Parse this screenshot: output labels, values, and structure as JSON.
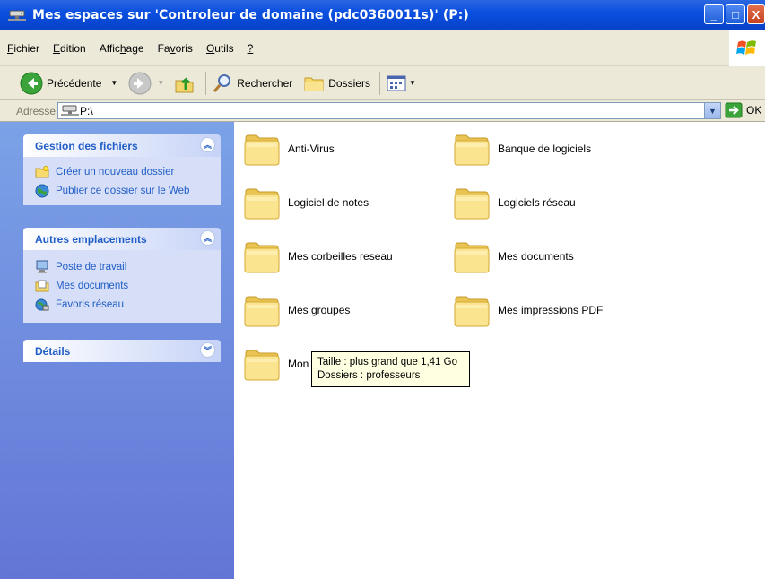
{
  "window": {
    "title": "Mes espaces sur 'Controleur de domaine (pdc0360011s)' (P:)",
    "buttons": {
      "minimize": "_",
      "maximize": "□",
      "close": "X"
    }
  },
  "menu": {
    "items": [
      {
        "pre": "",
        "ul": "F",
        "post": "ichier"
      },
      {
        "pre": "",
        "ul": "E",
        "post": "dition"
      },
      {
        "pre": "Affic",
        "ul": "h",
        "post": "age"
      },
      {
        "pre": "Fa",
        "ul": "v",
        "post": "oris"
      },
      {
        "pre": "",
        "ul": "O",
        "post": "utils"
      },
      {
        "pre": "",
        "ul": "?",
        "post": ""
      }
    ]
  },
  "toolbar": {
    "back_label": "Précédente",
    "search_label": "Rechercher",
    "folders_label": "Dossiers"
  },
  "address": {
    "label": "Adresse",
    "value": "P:\\",
    "go_label": "OK"
  },
  "sidebar": {
    "file_tasks": {
      "title": "Gestion des fichiers",
      "items": [
        {
          "label": "Créer un nouveau dossier"
        },
        {
          "label": "Publier ce dossier sur le Web"
        }
      ]
    },
    "other_places": {
      "title": "Autres emplacements",
      "items": [
        {
          "label": "Poste de travail"
        },
        {
          "label": "Mes documents"
        },
        {
          "label": "Favoris réseau"
        }
      ]
    },
    "details": {
      "title": "Détails"
    }
  },
  "folders": [
    {
      "name": "Anti-Virus"
    },
    {
      "name": "Banque de logiciels"
    },
    {
      "name": "Logiciel de notes"
    },
    {
      "name": "Logiciels réseau"
    },
    {
      "name": "Mes corbeilles reseau"
    },
    {
      "name": "Mes documents"
    },
    {
      "name": "Mes groupes"
    },
    {
      "name": "Mes impressions PDF"
    },
    {
      "name": "Mon"
    }
  ],
  "tooltip": {
    "line1": "Taille : plus grand que 1,41 Go",
    "line2": "Dossiers : professeurs"
  }
}
